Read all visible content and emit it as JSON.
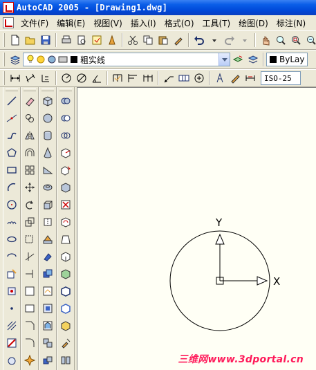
{
  "window": {
    "title": "AutoCAD 2005 - [Drawing1.dwg]"
  },
  "menubar": {
    "items": [
      {
        "label": "文件(F)"
      },
      {
        "label": "编辑(E)"
      },
      {
        "label": "视图(V)"
      },
      {
        "label": "插入(I)"
      },
      {
        "label": "格式(O)"
      },
      {
        "label": "工具(T)"
      },
      {
        "label": "绘图(D)"
      },
      {
        "label": "标注(N)"
      }
    ]
  },
  "layer_toolbar": {
    "linetype_label": "粗实线",
    "color_label": "ByLay"
  },
  "dim_toolbar": {
    "dimstyle": "ISO-25"
  },
  "canvas": {
    "y_label": "Y",
    "x_label": "X",
    "watermark": "三维网www.3dportal.cn"
  },
  "colors": {
    "titlebar": "#0a5ee8",
    "canvas_bg": "#fffff5",
    "watermark": "#ff1a5a"
  }
}
